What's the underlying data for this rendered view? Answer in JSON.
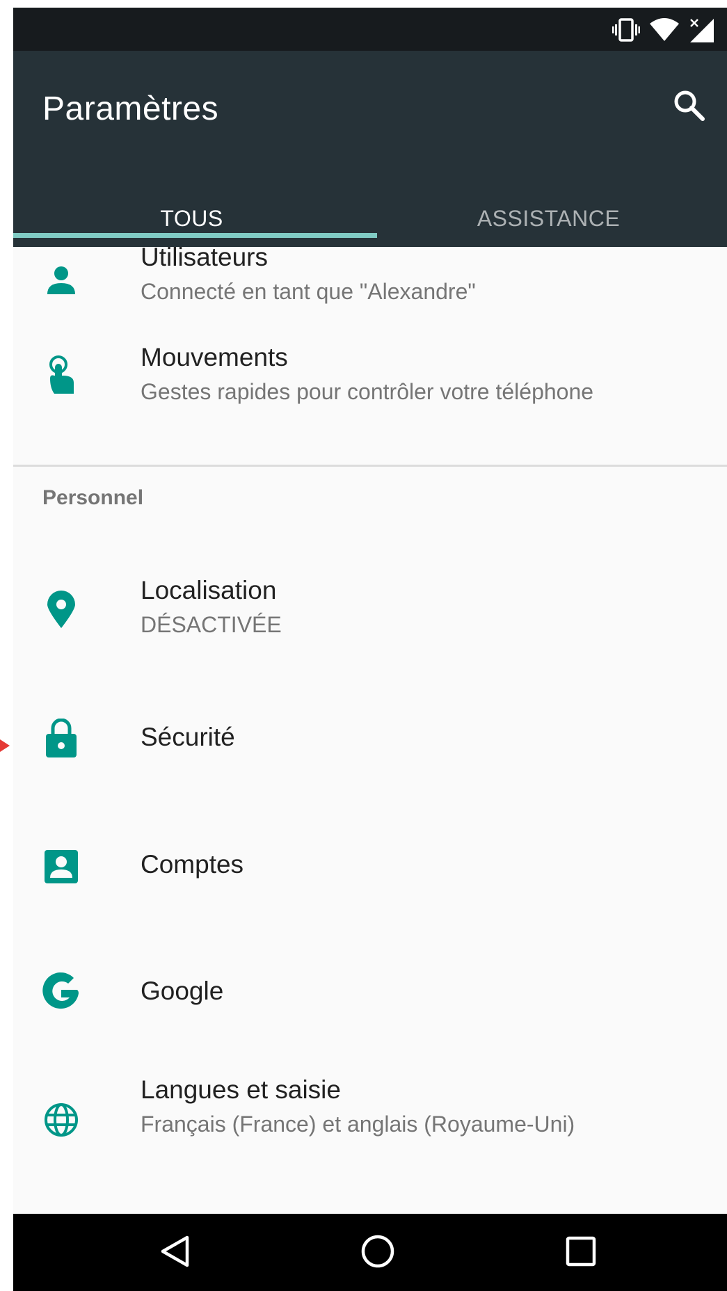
{
  "app": {
    "title": "Paramètres",
    "search_icon": "search-icon"
  },
  "status_bar": {
    "icons": [
      "vibrate-icon",
      "wifi-icon",
      "signal-no-data-icon"
    ]
  },
  "tabs": [
    {
      "label": "TOUS",
      "active": true
    },
    {
      "label": "ASSISTANCE",
      "active": false
    }
  ],
  "items": {
    "users": {
      "title": "Utilisateurs",
      "subtitle": "Connecté en tant que \"Alexandre\"",
      "icon": "person-icon"
    },
    "gestures": {
      "title": "Mouvements",
      "subtitle": "Gestes rapides pour contrôler votre téléphone",
      "icon": "gesture-hand-icon"
    },
    "location": {
      "title": "Localisation",
      "subtitle": "DÉSACTIVÉE",
      "icon": "location-pin-icon"
    },
    "security": {
      "title": "Sécurité",
      "icon": "lock-icon"
    },
    "accounts": {
      "title": "Comptes",
      "icon": "account-box-icon"
    },
    "google": {
      "title": "Google",
      "icon": "google-icon"
    },
    "languages": {
      "title": "Langues et saisie",
      "subtitle": "Français (France) et anglais (Royaume-Uni)",
      "icon": "globe-icon"
    }
  },
  "sections": {
    "personal": "Personnel"
  },
  "nav": {
    "icons": [
      "back-icon",
      "home-icon",
      "recents-icon"
    ]
  },
  "colors": {
    "accent": "#009688",
    "appbar": "#263238",
    "status_bar": "#171b1e",
    "tab_indicator": "#80cbc4",
    "background": "#fafafa"
  }
}
